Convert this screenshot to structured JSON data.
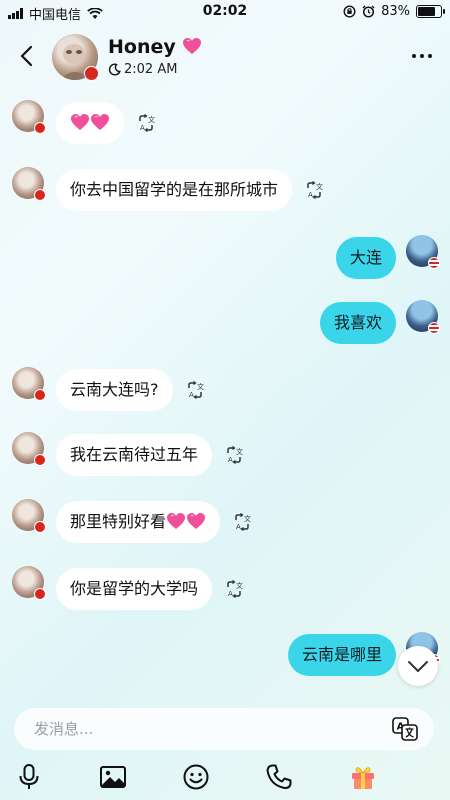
{
  "status_bar": {
    "carrier": "中国电信",
    "time": "02:02",
    "battery_text": "83%",
    "battery_level": 0.83
  },
  "header": {
    "name": "Honey",
    "name_emoji": "heart-emoji",
    "status_time": "2:02 AM",
    "status_icon": "moon-icon"
  },
  "messages": [
    {
      "side": "in",
      "text": "💗💗",
      "emoji": true
    },
    {
      "side": "in",
      "text": "你去中国留学的是在那所城市"
    },
    {
      "side": "out",
      "text": "大连"
    },
    {
      "side": "out",
      "text": "我喜欢"
    },
    {
      "side": "in",
      "text": "云南大连吗?"
    },
    {
      "side": "in",
      "text": "我在云南待过五年"
    },
    {
      "side": "in",
      "text": "那里特别好看💗💗"
    },
    {
      "side": "in",
      "text": "你是留学的大学吗"
    },
    {
      "side": "out",
      "text": "云南是哪里"
    }
  ],
  "composer": {
    "placeholder": "发消息..."
  },
  "toolbar": [
    "microphone-icon",
    "image-icon",
    "emoji-icon",
    "phone-icon",
    "gift-icon"
  ],
  "colors": {
    "outgoing_bubble": "#3bd5e9",
    "incoming_bubble": "#ffffff",
    "heart_pink": "#f0509a"
  }
}
